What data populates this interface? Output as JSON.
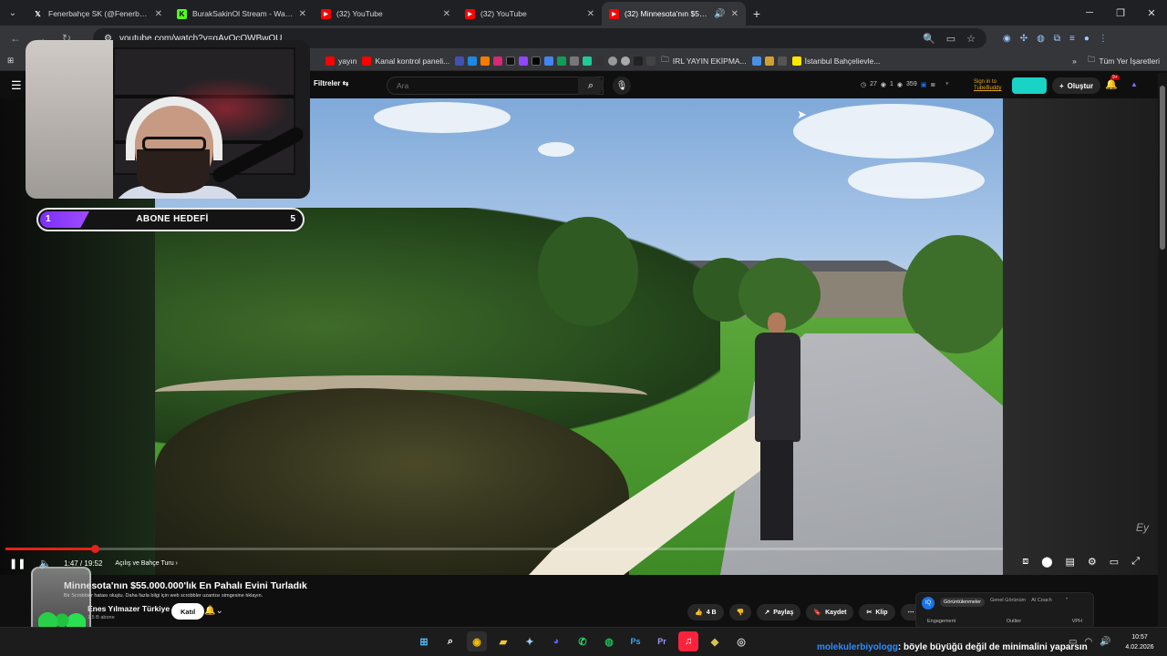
{
  "browser": {
    "tabs": [
      {
        "label": "Fenerbahçe SK (@Fenerbahçe)",
        "icon": "x-icon",
        "color": "#ffffff"
      },
      {
        "label": "BurakSakinOl Stream - Watch Li",
        "icon": "kick-icon",
        "color": "#53fc18"
      },
      {
        "label": "(32) YouTube",
        "icon": "youtube-icon",
        "color": "#ff0000"
      },
      {
        "label": "(32) YouTube",
        "icon": "youtube-icon",
        "color": "#ff0000"
      },
      {
        "label": "(32) Minnesota'nın $55.000",
        "icon": "youtube-icon",
        "color": "#ff0000"
      }
    ],
    "url": "youtube.com/watch?v=gAvOcOWBwOU",
    "bookmarks": [
      "yayın",
      "Kanal kontrol paneli...",
      "IRL YAYIN EKİPMA...",
      "İstanbul Bahçelievle..."
    ],
    "all_bookmarks": "Tüm Yer İşaretleri"
  },
  "youtube": {
    "filters_label": "Filtreler",
    "search_placeholder": "Ara",
    "stats": {
      "a": "27",
      "b": "1",
      "c": "359"
    },
    "signin_line1": "Sign in to",
    "signin_line2": "TubeBuddy",
    "create_label": "Oluştur",
    "notif_count": "9+"
  },
  "overlay": {
    "goal_current": "1",
    "goal_label": "ABONE HEDEFİ",
    "goal_target": "5",
    "goal_progress": 0.2
  },
  "player": {
    "time": "1:47 / 19:52",
    "chapter": "Açılış ve Bahçe Turu",
    "progress": 0.09,
    "watermark": "Ey"
  },
  "video": {
    "title": "Minnesota'nın $55.000.000'lık En Pahalı Evini Turladık",
    "error": "Bir Scrobbler hatası oluştu. Daha fazla bilgi için web scrobbler uzantısı simgesine tıklayın.",
    "channel": "Enes Yılmazer Türkiye",
    "subs": "1,5 B abone",
    "join": "Katıl",
    "likes": "4 B",
    "share": "Paylaş",
    "save": "Kaydet",
    "clip": "Klip"
  },
  "vidiq": {
    "tabs": [
      "Görüntülenmeler",
      "Genel Görünüm",
      "AI Coach"
    ],
    "row": [
      "Engagement",
      "Outlier",
      "VPH"
    ]
  },
  "taskbar": {
    "chat_user": "molekulerbiyologg",
    "chat_message": ": böyle büyüğü değil de minimalini yaparsın",
    "time": "10:57",
    "date": "4.02.2026"
  }
}
